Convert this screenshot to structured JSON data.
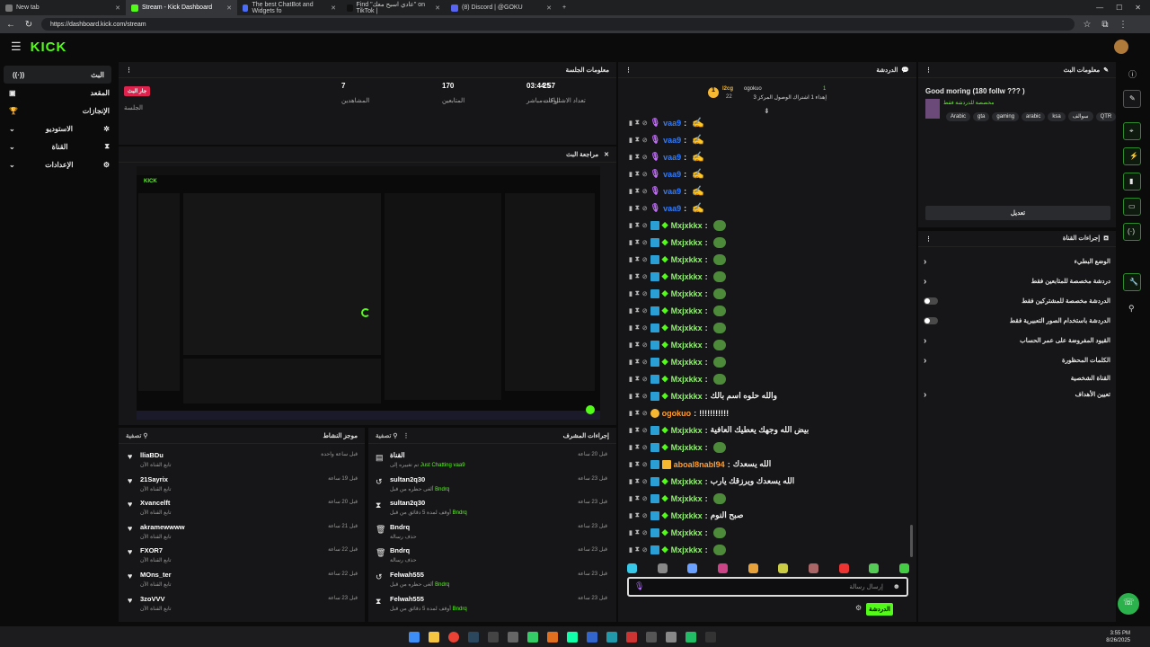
{
  "browser": {
    "tabs": [
      {
        "label": "New tab",
        "active": false,
        "color": "#888888"
      },
      {
        "label": "Stream - Kick Dashboard",
        "active": true,
        "color": "#53fc18"
      },
      {
        "label": "The best ChatBot and Widgets fo",
        "active": false,
        "color": "#4a6cf7"
      },
      {
        "label": "Find \"عادي اسيح معك\" on TikTok |",
        "active": false,
        "color": "#111111"
      },
      {
        "label": "(8) Discord | @GOKU",
        "active": false,
        "color": "#5865f2"
      }
    ],
    "url": "https://dashboard.kick.com/stream"
  },
  "header": {
    "logo": "KICK"
  },
  "sidebar": {
    "items": [
      {
        "label": "البث",
        "icon": "broadcast-icon",
        "active": true
      },
      {
        "label": "المقعد",
        "icon": "home-icon",
        "active": false
      },
      {
        "label": "الإنجازات",
        "icon": "trophy-icon",
        "active": false
      },
      {
        "label": "الاستوديو",
        "icon": "studio-icon",
        "active": false
      },
      {
        "label": "القناة",
        "icon": "channel-icon",
        "active": false
      },
      {
        "label": "الإعدادات",
        "icon": "gear-icon",
        "active": false
      }
    ]
  },
  "session": {
    "title": "معلومات الجلسة",
    "badge": "جار البث",
    "stats": [
      {
        "value": "",
        "label": "الجلسة"
      },
      {
        "value": "7",
        "label": "المشاهدين"
      },
      {
        "value": "170",
        "label": "المتابعين"
      },
      {
        "value": "25",
        "label": "تعداد الاشتراكات"
      },
      {
        "value": "03:44:57",
        "label": "الوقت مباشر"
      }
    ]
  },
  "preview": {
    "title": "مراجعة البث"
  },
  "activity": {
    "title": "موجز النشاط",
    "filter": "تصفية",
    "items": [
      {
        "name": "lliaBDu",
        "sub": "تابع القناة الآن",
        "time": "قبل ساعة واحدة"
      },
      {
        "name": "21Sayrix",
        "sub": "تابع القناة الآن",
        "time": "قبل 19 ساعة"
      },
      {
        "name": "Xvancelft",
        "sub": "تابع القناة الآن",
        "time": "قبل 20 ساعة"
      },
      {
        "name": "akramewwww",
        "sub": "تابع القناة الآن",
        "time": "قبل 21 ساعة"
      },
      {
        "name": "FXOR7",
        "sub": "تابع القناة الآن",
        "time": "قبل 22 ساعة"
      },
      {
        "name": "MOns_ter",
        "sub": "تابع القناة الآن",
        "time": "قبل 22 ساعة"
      },
      {
        "name": "3zoVVV",
        "sub": "تابع القناة الآن",
        "time": "قبل 23 ساعة"
      }
    ]
  },
  "modactions": {
    "title": "إجراءات المشرف",
    "filter": "تصفية",
    "items": [
      {
        "name": "القناة",
        "sub_green": "Just Chatting",
        "sub": "تم تغييره إلى",
        "by": "vaa9",
        "time": "قبل 20 ساعة",
        "icon": "channel-icon"
      },
      {
        "name": "sultan2q30",
        "sub_green": "Bndrq",
        "sub": "ألغى حظره من قبل",
        "by": "",
        "time": "قبل 23 ساعة",
        "icon": "undo-icon"
      },
      {
        "name": "sultan2q30",
        "sub_green": "Bndrq",
        "sub": "أوقف لمدة 5 دقائق من قبل",
        "by": "",
        "time": "قبل 23 ساعة",
        "icon": "hourglass-icon"
      },
      {
        "name": "Bndrq",
        "sub_green": "",
        "sub": "حذف رسالة",
        "by": "",
        "time": "قبل 23 ساعة",
        "icon": "trash-icon"
      },
      {
        "name": "Bndrq",
        "sub_green": "",
        "sub": "حذف رسالة",
        "by": "",
        "time": "قبل 23 ساعة",
        "icon": "trash-icon"
      },
      {
        "name": "Felwah555",
        "sub_green": "Bndrq",
        "sub": "ألغى حظره من قبل",
        "by": "",
        "time": "قبل 23 ساعة",
        "icon": "undo-icon"
      },
      {
        "name": "Felwah555",
        "sub_green": "Bndrq",
        "sub": "أوقف لمدة 5 دقائق من قبل",
        "by": "",
        "time": "قبل 23 ساعة",
        "icon": "hourglass-icon"
      }
    ]
  },
  "chat": {
    "title": "الدردشة",
    "pinned": {
      "user1": "l2cg",
      "user2": "ogokuo",
      "count1": "1",
      "count2": "22",
      "count3": "3",
      "text": "إهداء 1 اشتراك الوصول المركز"
    },
    "messages": [
      {
        "user": "vaa9",
        "text": "",
        "color": "#2f7bff"
      },
      {
        "user": "vaa9",
        "text": "",
        "color": "#2f7bff"
      },
      {
        "user": "vaa9",
        "text": "",
        "color": "#2f7bff"
      },
      {
        "user": "vaa9",
        "text": "",
        "color": "#2f7bff"
      },
      {
        "user": "vaa9",
        "text": "",
        "color": "#2f7bff"
      },
      {
        "user": "vaa9",
        "text": "",
        "color": "#2f7bff"
      },
      {
        "user": "Mxjxkkx",
        "text": "",
        "color": "#8ef36b"
      },
      {
        "user": "Mxjxkkx",
        "text": "",
        "color": "#8ef36b"
      },
      {
        "user": "Mxjxkkx",
        "text": "",
        "color": "#8ef36b"
      },
      {
        "user": "Mxjxkkx",
        "text": "",
        "color": "#8ef36b"
      },
      {
        "user": "Mxjxkkx",
        "text": "",
        "color": "#8ef36b"
      },
      {
        "user": "Mxjxkkx",
        "text": "",
        "color": "#8ef36b"
      },
      {
        "user": "Mxjxkkx",
        "text": "",
        "color": "#8ef36b"
      },
      {
        "user": "Mxjxkkx",
        "text": "",
        "color": "#8ef36b"
      },
      {
        "user": "Mxjxkkx",
        "text": "",
        "color": "#8ef36b"
      },
      {
        "user": "Mxjxkkx",
        "text": "",
        "color": "#8ef36b"
      },
      {
        "user": "Mxjxkkx",
        "text": "والله حلوه اسم بالك",
        "color": "#8ef36b"
      },
      {
        "user": "ogokuo",
        "text": "!!!!!!!!!!!",
        "color": "#ff9d2e"
      },
      {
        "user": "Mxjxkkx",
        "text": "بيض الله وجهك يعطيك العافية",
        "color": "#8ef36b"
      },
      {
        "user": "Mxjxkkx",
        "text": "",
        "color": "#8ef36b"
      },
      {
        "user": "aboal8nabl94",
        "text": "الله يسعدك",
        "color": "#ff9d2e"
      },
      {
        "user": "Mxjxkkx",
        "text": "الله يسعدك ويرزقك يارب",
        "color": "#8ef36b"
      },
      {
        "user": "Mxjxkkx",
        "text": "",
        "color": "#8ef36b"
      },
      {
        "user": "Mxjxkkx",
        "text": "صبح النوم",
        "color": "#8ef36b"
      },
      {
        "user": "Mxjxkkx",
        "text": "",
        "color": "#8ef36b"
      },
      {
        "user": "Mxjxkkx",
        "text": "",
        "color": "#8ef36b"
      }
    ],
    "input_placeholder": "إرسال رسالة",
    "send_label": "الدردشة"
  },
  "streaminfo": {
    "title": "معلومات البث",
    "stream_title": "Good moring (180 follw ??? )",
    "category": "مخصصة للدردشة فقط",
    "tags": [
      "Arabic",
      "gta",
      "gaming",
      "arabic",
      "ksa",
      "سوالف",
      "QTR"
    ],
    "edit_label": "تعديل"
  },
  "channelactions": {
    "title": "إجراءات القناة",
    "options": [
      {
        "label": "الوضع البطيء",
        "control": "chevron"
      },
      {
        "label": "دردشة مخصصة للمتابعين فقط",
        "control": "chevron"
      },
      {
        "label": "الدردشة مخصصة للمشتركين فقط",
        "control": "toggle"
      },
      {
        "label": "الدردشة باستخدام الصور التعبيرية فقط",
        "control": "toggle"
      },
      {
        "label": "القيود المفروضة على عمر الحساب",
        "control": "chevron"
      },
      {
        "label": "الكلمات المحظورة",
        "control": "chevron"
      },
      {
        "label": "القناة الشخصية",
        "control": "none"
      },
      {
        "label": "تعيين الأهداف",
        "control": "chevron"
      }
    ]
  },
  "taskbar": {
    "time": "3:55 PM",
    "date": "8/26/2025"
  }
}
